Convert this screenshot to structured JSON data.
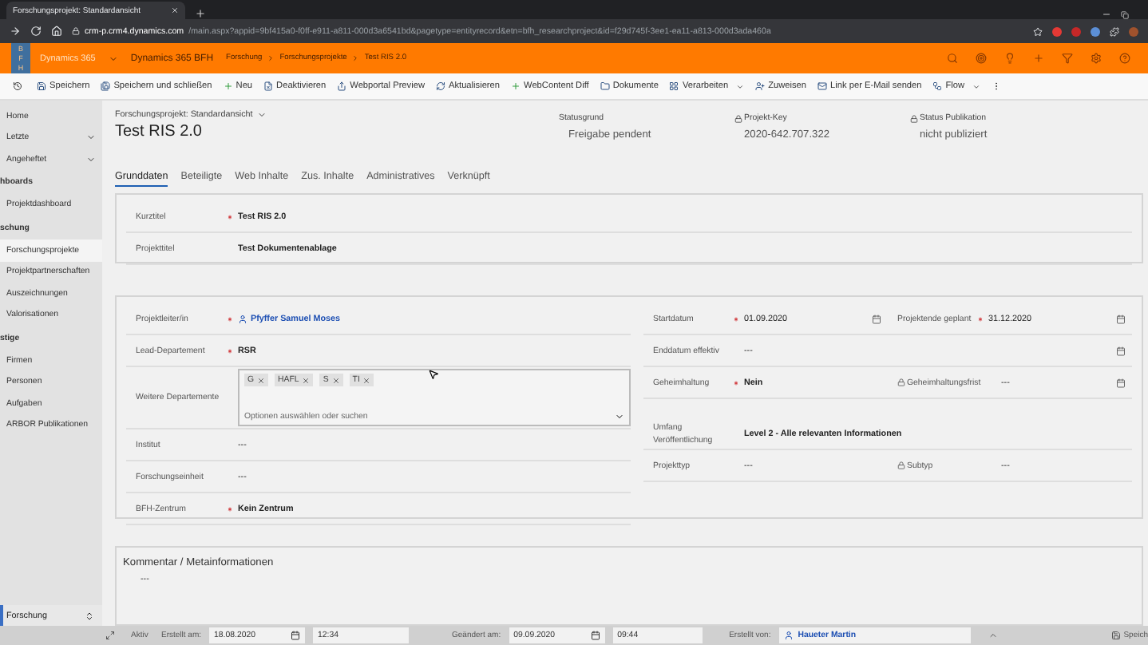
{
  "browser": {
    "tab_title": "Forschungsprojekt: Standardansicht",
    "url_host": "crm-p.crm4.dynamics.com",
    "url_path": "/main.aspx?appid=9bf415a0-f0ff-e911-a811-000d3a6541bd&pagetype=entityrecord&etn=bfh_researchproject&id=f29d745f-3ee1-ea11-a813-000d3ada460a"
  },
  "header": {
    "logo": [
      "B",
      "F",
      "H"
    ],
    "app_name": "Dynamics 365",
    "app_title": "Dynamics 365 BFH",
    "breadcrumb": [
      "Forschung",
      "Forschungsprojekte",
      "Test RIS 2.0"
    ]
  },
  "commands": [
    {
      "label": "Speichern",
      "dropdown": false
    },
    {
      "label": "Speichern und schließen",
      "dropdown": false
    },
    {
      "label": "Neu",
      "dropdown": false
    },
    {
      "label": "Deaktivieren",
      "dropdown": false
    },
    {
      "label": "Webportal Preview",
      "dropdown": false
    },
    {
      "label": "Aktualisieren",
      "dropdown": false
    },
    {
      "label": "WebContent Diff",
      "dropdown": false
    },
    {
      "label": "Dokumente",
      "dropdown": false
    },
    {
      "label": "Verarbeiten",
      "dropdown": true
    },
    {
      "label": "Zuweisen",
      "dropdown": false
    },
    {
      "label": "Link per E-Mail senden",
      "dropdown": false
    },
    {
      "label": "Flow",
      "dropdown": true
    }
  ],
  "sidebar": {
    "items": [
      {
        "label": "Home",
        "kind": "link",
        "selected": false
      },
      {
        "label": "Letzte",
        "kind": "expander",
        "selected": false
      },
      {
        "label": "Angeheftet",
        "kind": "expander",
        "selected": false
      },
      {
        "label": "hboards",
        "kind": "heading",
        "selected": false
      },
      {
        "label": "Projektdashboard",
        "kind": "link",
        "selected": false
      },
      {
        "label": "schung",
        "kind": "heading",
        "selected": false
      },
      {
        "label": "Forschungsprojekte",
        "kind": "link",
        "selected": true
      },
      {
        "label": "Projektpartnerschaften",
        "kind": "link",
        "selected": false
      },
      {
        "label": "Auszeichnungen",
        "kind": "link",
        "selected": false
      },
      {
        "label": "Valorisationen",
        "kind": "link",
        "selected": false
      },
      {
        "label": "stige",
        "kind": "heading",
        "selected": false
      },
      {
        "label": "Firmen",
        "kind": "link",
        "selected": false
      },
      {
        "label": "Personen",
        "kind": "link",
        "selected": false
      },
      {
        "label": "Aufgaben",
        "kind": "link",
        "selected": false
      },
      {
        "label": "ARBOR Publikationen",
        "kind": "link",
        "selected": false
      }
    ],
    "area": "Forschung"
  },
  "record": {
    "view": "Forschungsprojekt: Standardansicht",
    "title": "Test RIS 2.0",
    "header_fields": [
      {
        "label": "Statusgrund",
        "value": "Freigabe pendent",
        "locked": false
      },
      {
        "label": "Projekt-Key",
        "value": "2020-642.707.322",
        "locked": true
      },
      {
        "label": "Status Publikation",
        "value": "nicht publiziert",
        "locked": true
      }
    ]
  },
  "tabs": [
    {
      "label": "Grunddaten",
      "selected": true
    },
    {
      "label": "Beteiligte",
      "selected": false
    },
    {
      "label": "Web Inhalte",
      "selected": false
    },
    {
      "label": "Zus. Inhalte",
      "selected": false
    },
    {
      "label": "Administratives",
      "selected": false
    },
    {
      "label": "Verknüpft",
      "selected": false
    }
  ],
  "general_section": [
    {
      "label": "Kurztitel",
      "required": true,
      "kind": "text",
      "value": "Test RIS 2.0",
      "bold": true
    },
    {
      "label": "Projekttitel",
      "required": false,
      "kind": "text",
      "value": "Test Dokumentenablage",
      "bold": true
    }
  ],
  "details_left": [
    {
      "label": "Projektleiter/in",
      "required": true,
      "kind": "lookup",
      "value": "Pfyffer Samuel Moses",
      "bold": true
    },
    {
      "label": "Lead-Departement",
      "required": true,
      "kind": "text",
      "value": "RSR",
      "bold": true
    },
    {
      "label": "Weitere Departemente",
      "required": false,
      "kind": "multiselect",
      "tags": [
        "G",
        "HAFL",
        "S",
        "TI"
      ],
      "placeholder": "Optionen auswählen oder suchen"
    },
    {
      "label": "Institut",
      "required": false,
      "kind": "text",
      "value": "---",
      "bold": false
    },
    {
      "label": "Forschungseinheit",
      "required": false,
      "kind": "text",
      "value": "---",
      "bold": false
    },
    {
      "label": "BFH-Zentrum",
      "required": true,
      "kind": "text",
      "value": "Kein Zentrum",
      "bold": true
    }
  ],
  "details_right": [
    [
      {
        "label": "Startdatum",
        "required": true,
        "locked": false,
        "value": "01.09.2020",
        "bold": false,
        "date": true
      },
      {
        "label": "Projektende geplant",
        "required": true,
        "locked": false,
        "value": "31.12.2020",
        "bold": false,
        "date": true
      }
    ],
    [
      {
        "label": "Enddatum effektiv",
        "required": false,
        "locked": false,
        "value": "---",
        "bold": false,
        "date": true
      }
    ],
    [
      {
        "label": "Geheimhaltung",
        "required": true,
        "locked": false,
        "value": "Nein",
        "bold": true,
        "date": false
      },
      {
        "label": "Geheimhaltungsfrist",
        "required": false,
        "locked": true,
        "value": "---",
        "bold": false,
        "date": true
      }
    ],
    [
      {
        "label": "Umfang Veröffentlichung",
        "required": false,
        "locked": false,
        "value": "Level 2 - Alle relevanten Informationen",
        "bold": true,
        "date": false
      }
    ],
    [
      {
        "label": "Projekttyp",
        "required": false,
        "locked": false,
        "value": "---",
        "bold": false,
        "date": false
      },
      {
        "label": "Subtyp",
        "required": false,
        "locked": true,
        "value": "---",
        "bold": false,
        "date": false
      }
    ]
  ],
  "comment": {
    "title": "Kommentar / Metainformationen",
    "value": "---"
  },
  "footer": {
    "status": "Aktiv",
    "created_label": "Erstellt am:",
    "created_date": "18.08.2020",
    "created_time": "12:34",
    "modified_label": "Geändert am:",
    "modified_date": "09.09.2020",
    "modified_time": "09:44",
    "created_by_label": "Erstellt von:",
    "created_by": "Haueter Martin",
    "save": "Speich"
  }
}
